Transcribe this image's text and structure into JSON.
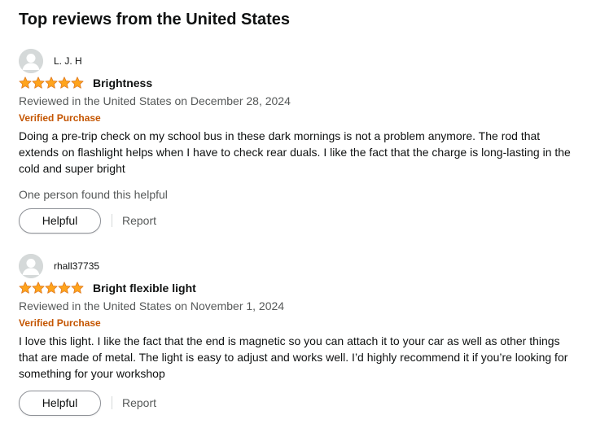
{
  "section_title": "Top reviews from the United States",
  "colors": {
    "star": "#ffa41c",
    "verified": "#c45500",
    "secondary_text": "#565959"
  },
  "reviews": [
    {
      "reviewer": "L. J. H",
      "rating": 5,
      "title": "Brightness",
      "date": "Reviewed in the United States on December 28, 2024",
      "verified": "Verified Purchase",
      "body": "Doing a pre-trip check on my school bus in these dark mornings is not a problem anymore. The rod that extends on flashlight helps when I have to check rear duals. I like the fact that the charge is long-lasting in the cold and super bright",
      "helpful_count": "One person found this helpful",
      "helpful_label": "Helpful",
      "report_label": "Report"
    },
    {
      "reviewer": "rhall37735",
      "rating": 5,
      "title": "Bright flexible light",
      "date": "Reviewed in the United States on November 1, 2024",
      "verified": "Verified Purchase",
      "body": "I love this light. I like the fact that the end is magnetic so you can attach it to your car as well as other things that are made of metal. The light is easy to adjust and works well. I’d highly recommend it if you’re looking for something for your workshop",
      "helpful_count": "",
      "helpful_label": "Helpful",
      "report_label": "Report"
    }
  ]
}
